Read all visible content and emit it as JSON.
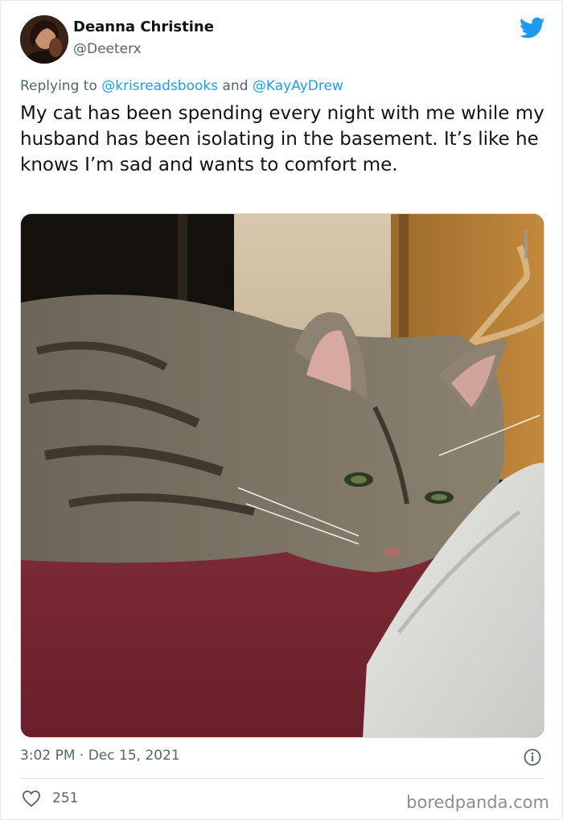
{
  "author": {
    "name": "Deanna Christine",
    "handle": "@Deeterx"
  },
  "reply": {
    "prefix": "Replying to",
    "mention1": "@krisreadsbooks",
    "and": "and",
    "mention2": "@KayAyDrew"
  },
  "tweet": {
    "text": "My cat has been spending every night with me while my husband has been isolating in the basement. It’s like he knows I’m sad and wants to comfort me.",
    "time": "3:02 PM",
    "separator": "·",
    "date": "Dec 15, 2021"
  },
  "engagement": {
    "likes": "251"
  },
  "watermark": "boredpanda.com",
  "colors": {
    "twitter_blue": "#1d9bf0",
    "secondary_text": "#536471"
  },
  "icons": [
    "twitter-bird-icon",
    "info-icon",
    "heart-icon"
  ]
}
